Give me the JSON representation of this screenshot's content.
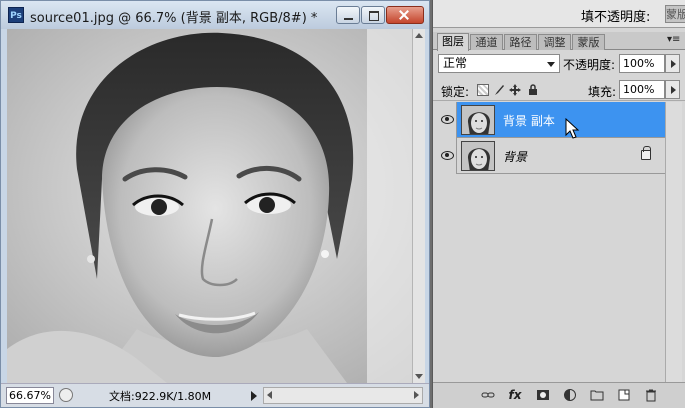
{
  "document": {
    "app_icon": "Ps",
    "title": "source01.jpg @ 66.7% (背景 副本, RGB/8#) *",
    "zoom": "66.67%",
    "doc_info": "文档:922.9K/1.80M",
    "image": "grayscale portrait of a smiling woman"
  },
  "panel_top": {
    "opacity_label": "填不透明度:",
    "tab_stub": "蒙版"
  },
  "layers_panel": {
    "tabs": [
      "图层",
      "通道",
      "路径",
      "调整",
      "蒙版"
    ],
    "active_tab": 0,
    "menu_icon": "▾≡",
    "blend_mode": "正常",
    "opacity_label": "不透明度:",
    "opacity_value": "100%",
    "lock_label": "锁定:",
    "fill_label": "填充:",
    "fill_value": "100%",
    "layers": [
      {
        "name": "背景 副本",
        "selected": true,
        "visible": true,
        "locked": false
      },
      {
        "name": "背景",
        "selected": false,
        "visible": true,
        "locked": true
      }
    ],
    "footer_icons": [
      "link-icon",
      "fx-icon",
      "mask-icon",
      "adjustment-icon",
      "folder-icon",
      "new-layer-icon",
      "trash-icon"
    ]
  },
  "colors": {
    "selection": "#3d93f0",
    "title_bar": "#c8d6e6",
    "close_button": "#c4452d"
  }
}
